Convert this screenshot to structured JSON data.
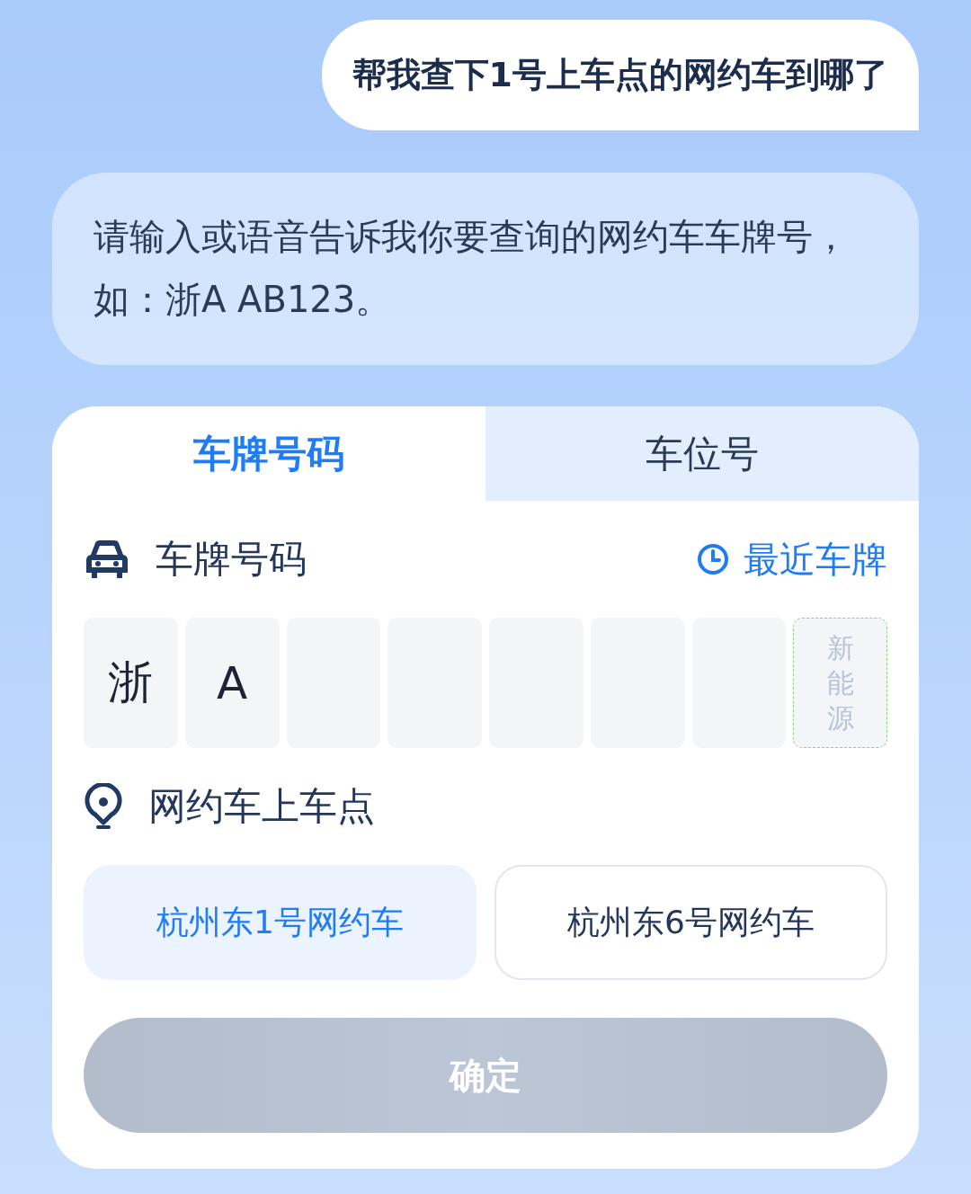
{
  "user_message": {
    "text": "帮我查下1号上车点的网约车到哪了"
  },
  "assistant_message": {
    "text": "请输入或语音告诉我你要查询的网约车车牌号，如：浙A AB123。"
  },
  "tabs": [
    {
      "label": "车牌号码",
      "selected": true
    },
    {
      "label": "车位号",
      "selected": false
    }
  ],
  "plate_section": {
    "label": "车牌号码",
    "recent_link": "最近车牌"
  },
  "plate_cells": [
    {
      "kind": "char",
      "value": "浙"
    },
    {
      "kind": "char",
      "value": "A"
    },
    {
      "kind": "empty"
    },
    {
      "kind": "empty"
    },
    {
      "kind": "empty"
    },
    {
      "kind": "empty"
    },
    {
      "kind": "empty"
    },
    {
      "kind": "new_energy",
      "label": "新能源"
    }
  ],
  "pickup_section": {
    "label": "网约车上车点"
  },
  "pickup_options": [
    {
      "label": "杭州东1号网约车",
      "selected": true
    },
    {
      "label": "杭州东6号网约车",
      "selected": false
    }
  ],
  "confirm_button": {
    "label": "确定",
    "disabled": true
  }
}
